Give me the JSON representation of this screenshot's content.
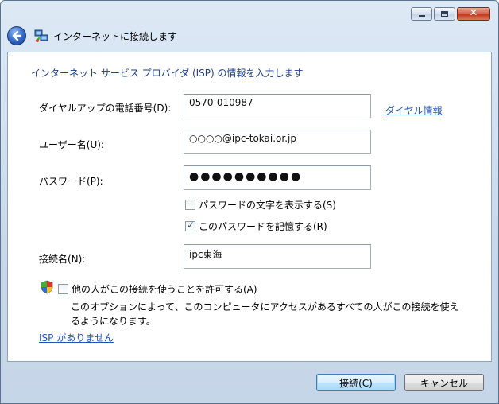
{
  "window": {
    "title": "インターネットに接続します",
    "close_symbol": "✕"
  },
  "heading": "インターネット サービス プロバイダ (ISP) の情報を入力します",
  "form": {
    "phone": {
      "label": "ダイヤルアップの電話番号(D):",
      "value": "0570-010987"
    },
    "dialing_rules_link": "ダイヤル情報",
    "username": {
      "label": "ユーザー名(U):",
      "value": "○○○○@ipc-tokai.or.jp"
    },
    "password": {
      "label": "パスワード(P):",
      "masked_value": "●●●●●●●●●●"
    },
    "show_password": {
      "label": "パスワードの文字を表示する(S)",
      "checked": false
    },
    "remember_password": {
      "label": "このパスワードを記憶する(R)",
      "checked": true
    },
    "connection_name": {
      "label": "接続名(N):",
      "value": "ipc東海"
    },
    "allow_others": {
      "label": "他の人がこの接続を使うことを許可する(A)",
      "checked": false,
      "description": "このオプションによって、このコンピュータにアクセスがあるすべての人がこの接続を使えるようになります。"
    },
    "no_isp_link": "ISP がありません"
  },
  "buttons": {
    "connect": "接続(C)",
    "cancel": "キャンセル"
  },
  "colors": {
    "heading": "#1e3f8f",
    "link": "#2155b5",
    "back_button": "#2f66c4"
  },
  "icons": [
    "back-arrow-icon",
    "network-connection-icon",
    "uac-shield-icon",
    "minimize-icon",
    "maximize-icon",
    "close-icon"
  ]
}
